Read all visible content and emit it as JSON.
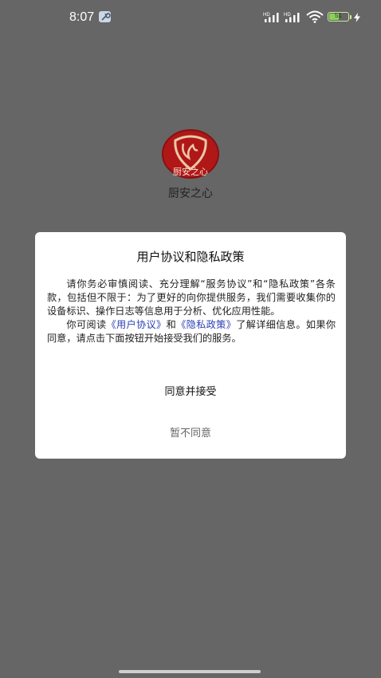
{
  "status_bar": {
    "time": "8:07",
    "signal_1_label": "HD",
    "signal_2_label": "HD",
    "battery_level": "51"
  },
  "app": {
    "logo_text": "厨安之心",
    "name": "厨安之心"
  },
  "dialog": {
    "title": "用户协议和隐私政策",
    "paragraph1": "请你务必审慎阅读、充分理解“服务协议”和“隐私政策”各条款，包括但不限于：为了更好的向你提供服务，我们需要收集你的设备标识、操作日志等信息用于分析、优化应用性能。",
    "p2_prefix": "你可阅读",
    "user_agreement_link": "《用户协议》",
    "p2_and": "和",
    "privacy_policy_link": "《隐私政策》",
    "p2_suffix": "了解详细信息。如果你同意，请点击下面按钮开始接受我们的服务。",
    "accept_label": "同意并接受",
    "decline_label": "暂不同意"
  },
  "colors": {
    "overlay": "#666666",
    "link": "#2b3fb4",
    "logo_red": "#b01818",
    "battery_green": "#8bd05a"
  }
}
